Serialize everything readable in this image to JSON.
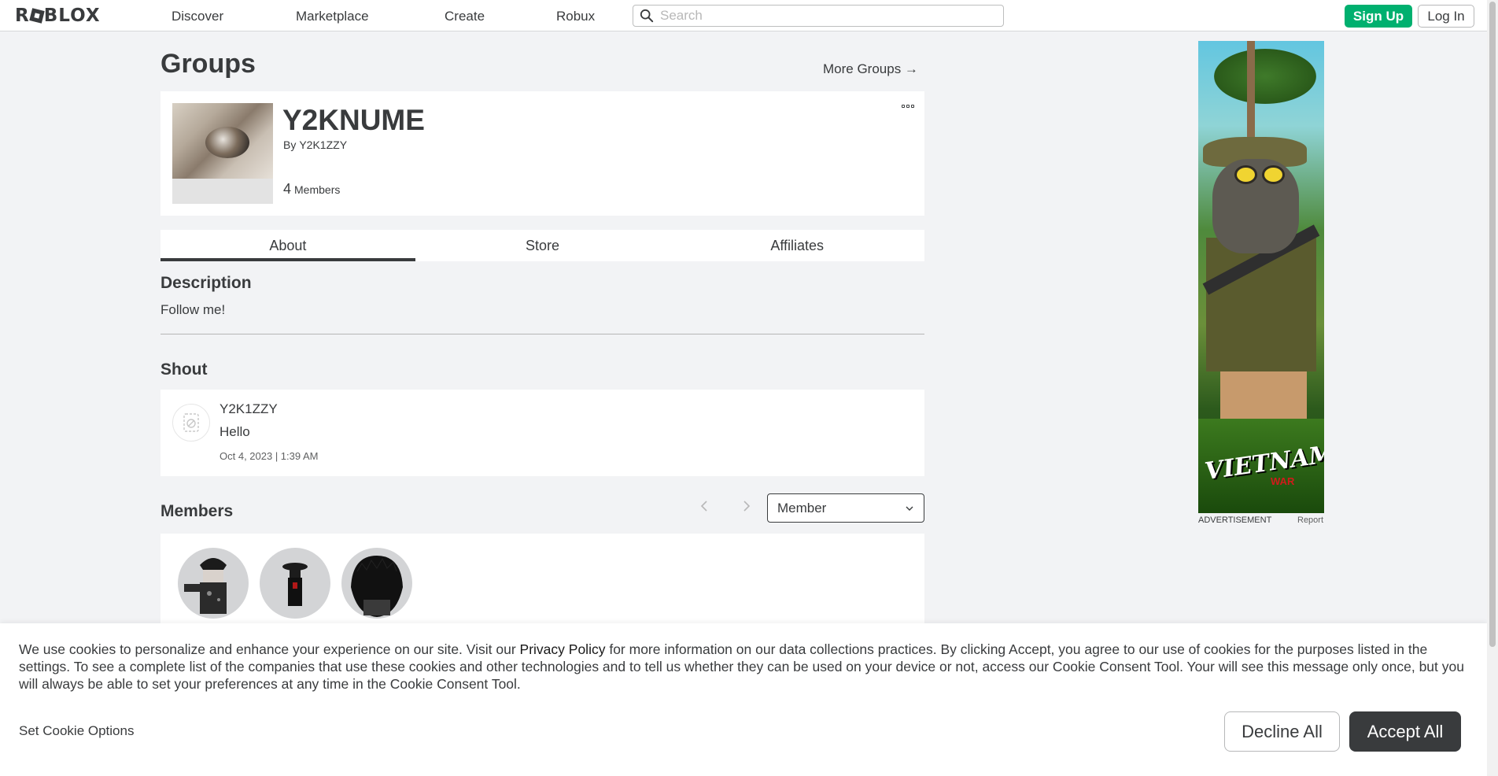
{
  "nav": {
    "logo": "ROBLOX",
    "links": [
      "Discover",
      "Marketplace",
      "Create",
      "Robux"
    ],
    "search_placeholder": "Search",
    "signup_label": "Sign Up",
    "login_label": "Log In"
  },
  "page": {
    "title": "Groups",
    "more_groups": "More Groups →"
  },
  "group": {
    "name": "Y2KNUME",
    "by_label": "By",
    "owner": "Y2K1ZZY",
    "member_count": "4",
    "members_label": "Members"
  },
  "tabs": [
    {
      "label": "About",
      "active": true
    },
    {
      "label": "Store",
      "active": false
    },
    {
      "label": "Affiliates",
      "active": false
    }
  ],
  "description": {
    "heading": "Description",
    "text": "Follow me!"
  },
  "shout": {
    "heading": "Shout",
    "user": "Y2K1ZZY",
    "body": "Hello",
    "date": "Oct 4, 2023 | 1:39 AM"
  },
  "members": {
    "heading": "Members",
    "role_selected": "Member"
  },
  "ad": {
    "brand_title": "VIETNAM",
    "brand_sub": "WAR",
    "label": "ADVERTISEMENT",
    "report": "Report"
  },
  "cookie": {
    "text_before": "We use cookies to personalize and enhance your experience on our site. Visit our ",
    "privacy_link": "Privacy Policy",
    "text_after": " for more information on our data collections practices. By clicking Accept, you agree to our use of cookies for the purposes listed in the settings. To see a complete list of the companies that use these cookies and other technologies and to tell us whether they can be used on your device or not, access our Cookie Consent Tool. Your will see this message only once, but you will always be able to set your preferences at any time in the Cookie Consent Tool.",
    "set_options": "Set Cookie Options",
    "decline": "Decline All",
    "accept": "Accept All"
  },
  "colors": {
    "accent_green": "#00b06f",
    "text_primary": "#393b3d",
    "page_bg": "#f2f3f5"
  }
}
